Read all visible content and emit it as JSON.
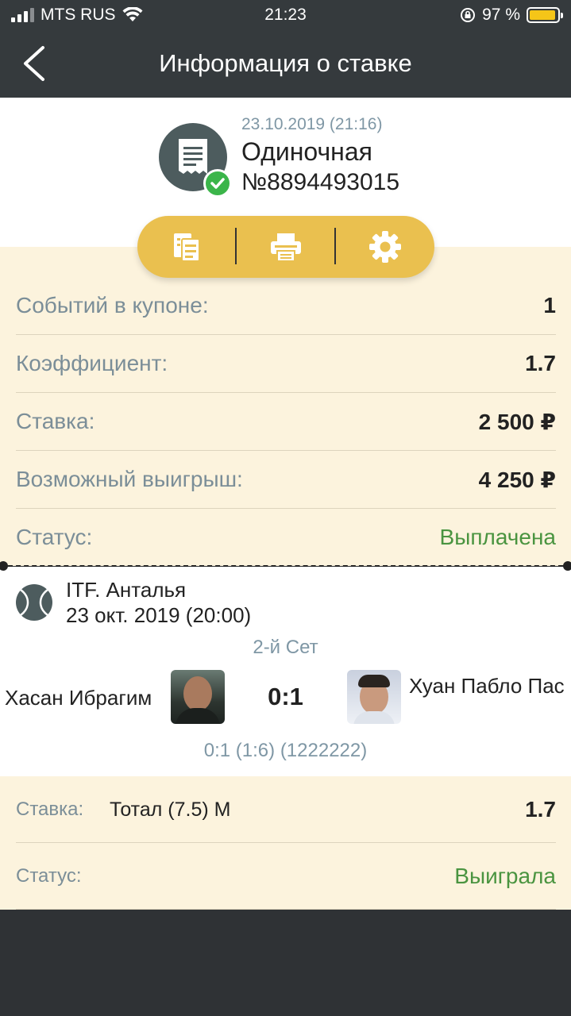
{
  "status_bar": {
    "carrier": "MTS RUS",
    "time": "21:23",
    "battery": "97 %"
  },
  "nav": {
    "title": "Информация о ставке"
  },
  "coupon": {
    "date": "23.10.2019 (21:16)",
    "type": "Одиночная",
    "number": "№8894493015"
  },
  "info_rows": [
    {
      "label": "Событий в купоне:",
      "value": "1"
    },
    {
      "label": "Коэффициент:",
      "value": "1.7"
    },
    {
      "label": "Ставка:",
      "value": "2 500 ₽"
    },
    {
      "label": "Возможный выигрыш:",
      "value": "4 250 ₽"
    },
    {
      "label": "Статус:",
      "value": "Выплачена"
    }
  ],
  "event": {
    "tournament": "ITF. Анталья",
    "date": "23 окт. 2019 (20:00)",
    "set": "2-й Сет",
    "player1": "Хасан Ибрагим",
    "player2": "Хуан Пабло Пас",
    "score": "0:1",
    "detail": "0:1 (1:6) (1222222)"
  },
  "bet": {
    "stake_label": "Ставка:",
    "stake_value": "Тотал (7.5) М",
    "odds": "1.7",
    "status_label": "Статус:",
    "status_value": "Выиграла"
  },
  "colors": {
    "accent": "#eac04f",
    "success": "#4a9440",
    "muted": "#7b8e98"
  }
}
